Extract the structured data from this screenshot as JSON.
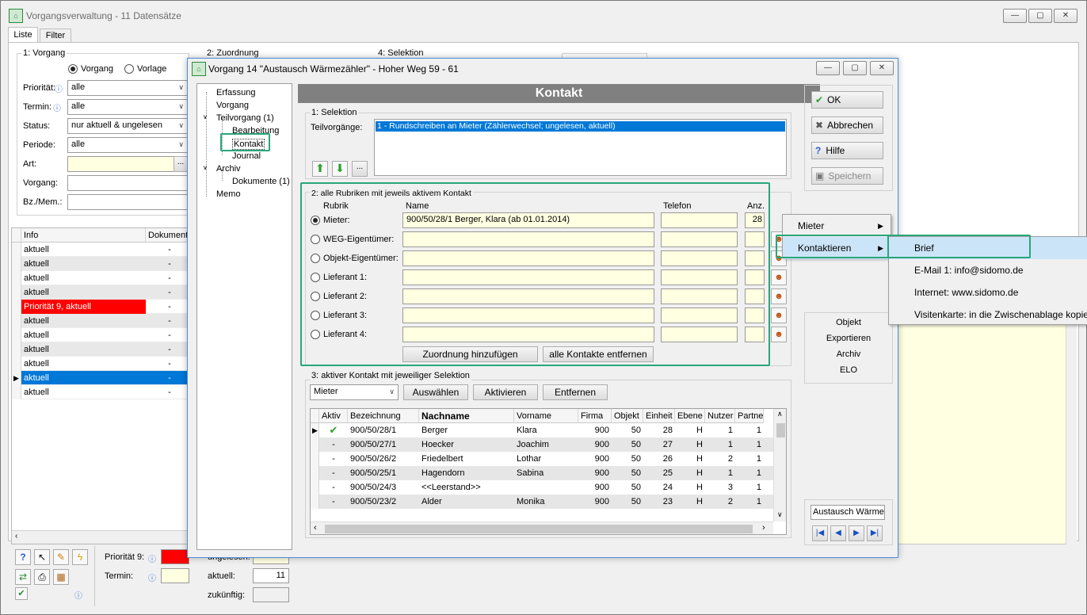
{
  "main_window": {
    "title": "Vorgangsverwaltung - 11 Datensätze",
    "tabs": [
      "Liste",
      "Filter"
    ],
    "groups": {
      "g1": "1: Vorgang",
      "g2": "2: Zuordnung",
      "g4": "4: Selektion"
    },
    "radio_vorgang": "Vorgang",
    "radio_vorlage": "Vorlage",
    "filters": [
      {
        "label": "Priorität:",
        "value": "alle"
      },
      {
        "label": "Termin:",
        "value": "alle"
      },
      {
        "label": "Status:",
        "value": "nur aktuell & ungelesen"
      },
      {
        "label": "Periode:",
        "value": "alle"
      }
    ],
    "art_label": "Art:",
    "vorgang_label": "Vorgang:",
    "bzmem_label": "Bz./Mem.:",
    "ellipsis": "...",
    "list_headers": [
      "Info",
      "Dokumente"
    ],
    "list_rows": [
      {
        "info": "aktuell",
        "doc": "-"
      },
      {
        "info": "aktuell",
        "doc": "-"
      },
      {
        "info": "aktuell",
        "doc": "-"
      },
      {
        "info": "aktuell",
        "doc": "-"
      },
      {
        "info": "Priorität 9, aktuell",
        "doc": "-"
      },
      {
        "info": "aktuell",
        "doc": "-"
      },
      {
        "info": "aktuell",
        "doc": "-"
      },
      {
        "info": "aktuell",
        "doc": "-"
      },
      {
        "info": "aktuell",
        "doc": "-"
      },
      {
        "info": "aktuell",
        "doc": "-"
      },
      {
        "info": "aktuell",
        "doc": "-"
      }
    ],
    "bottom": {
      "prio_label": "Priorität 9:",
      "termin_label": "Termin:",
      "ungelesen_label": "ungelesen:",
      "aktuell_label": "aktuell:",
      "aktuell_value": "11",
      "zukuenftig_label": "zukünftig:"
    }
  },
  "dialog": {
    "title": "Vorgang 14 \"Austausch Wärmezähler\" - Hoher Weg 59 - 61",
    "header": "Kontakt",
    "tree": [
      "Erfassung",
      "Vorgang",
      "Teilvorgang (1)",
      "Bearbeitung",
      "Kontakt",
      "Journal",
      "Archiv",
      "Dokumente (1)",
      "Memo"
    ],
    "sel_group": "1: Selektion",
    "teilvorgaenge_label": "Teilvorgänge:",
    "teilvorgang_item": "1 - Rundschreiben an Mieter (Zählerwechsel;  ungelesen, aktuell)",
    "rub_group": "2: alle Rubriken mit jeweils aktivem Kontakt",
    "rub_headers": {
      "rubrik": "Rubrik",
      "name": "Name",
      "telefon": "Telefon",
      "anz": "Anz."
    },
    "rubriken": [
      {
        "label": "Mieter:",
        "name": "900/50/28/1  Berger, Klara  (ab 01.01.2014)",
        "anz": "28"
      },
      {
        "label": "WEG-Eigentümer:",
        "name": "",
        "anz": ""
      },
      {
        "label": "Objekt-Eigentümer:",
        "name": "",
        "anz": ""
      },
      {
        "label": "Lieferant 1:",
        "name": "",
        "anz": ""
      },
      {
        "label": "Lieferant 2:",
        "name": "",
        "anz": ""
      },
      {
        "label": "Lieferant 3:",
        "name": "",
        "anz": ""
      },
      {
        "label": "Lieferant 4:",
        "name": "",
        "anz": ""
      }
    ],
    "btn_zuordnung": "Zuordnung hinzufügen",
    "btn_entfernen_alle": "alle Kontakte entfernen",
    "akt_group": "3: aktiver Kontakt mit jeweiliger Selektion",
    "akt_select": "Mieter",
    "btn_auswaehlen": "Auswählen",
    "btn_aktivieren": "Aktivieren",
    "btn_entfernen": "Entfernen",
    "contact_headers": [
      "Aktiv",
      "Bezeichnung",
      "Nachname",
      "Vorname",
      "Firma",
      "Objekt",
      "Einheit",
      "Ebene",
      "Nutzer",
      "Partne"
    ],
    "contacts": [
      {
        "aktiv": "✔",
        "bez": "900/50/28/1",
        "nach": "Berger",
        "vor": "Klara",
        "firma": "900",
        "objekt": "50",
        "einheit": "28",
        "ebene": "H",
        "nutzer": "1",
        "partner": "1"
      },
      {
        "aktiv": "-",
        "bez": "900/50/27/1",
        "nach": "Hoecker",
        "vor": "Joachim",
        "firma": "900",
        "objekt": "50",
        "einheit": "27",
        "ebene": "H",
        "nutzer": "1",
        "partner": "1"
      },
      {
        "aktiv": "-",
        "bez": "900/50/26/2",
        "nach": "Friedelbert",
        "vor": "Lothar",
        "firma": "900",
        "objekt": "50",
        "einheit": "26",
        "ebene": "H",
        "nutzer": "2",
        "partner": "1"
      },
      {
        "aktiv": "-",
        "bez": "900/50/25/1",
        "nach": "Hagendorn",
        "vor": "Sabina",
        "firma": "900",
        "objekt": "50",
        "einheit": "25",
        "ebene": "H",
        "nutzer": "1",
        "partner": "1"
      },
      {
        "aktiv": "-",
        "bez": "900/50/24/3",
        "nach": "<<Leerstand>>",
        "vor": "",
        "firma": "900",
        "objekt": "50",
        "einheit": "24",
        "ebene": "H",
        "nutzer": "3",
        "partner": "1"
      },
      {
        "aktiv": "-",
        "bez": "900/50/23/2",
        "nach": "Alder",
        "vor": "Monika",
        "firma": "900",
        "objekt": "50",
        "einheit": "23",
        "ebene": "H",
        "nutzer": "2",
        "partner": "1"
      }
    ],
    "buttons": {
      "ok": "OK",
      "abbrechen": "Abbrechen",
      "hilfe": "Hilfe",
      "speichern": "Speichern"
    },
    "side_links": [
      "Objekt",
      "Exportieren",
      "Archiv",
      "ELO"
    ],
    "austausch": "Austausch Wärme"
  },
  "context_menu": {
    "items": [
      "Mieter",
      "Kontaktieren"
    ],
    "submenu": [
      "Brief",
      "E-Mail 1: info@sidomo.de",
      "Internet: www.sidomo.de",
      "Visitenkarte: in die Zwischenablage kopieren"
    ]
  },
  "colors": {
    "accent": "#29a67a",
    "selection": "#0078d7",
    "priority": "#ff0000",
    "header": "#808080"
  }
}
